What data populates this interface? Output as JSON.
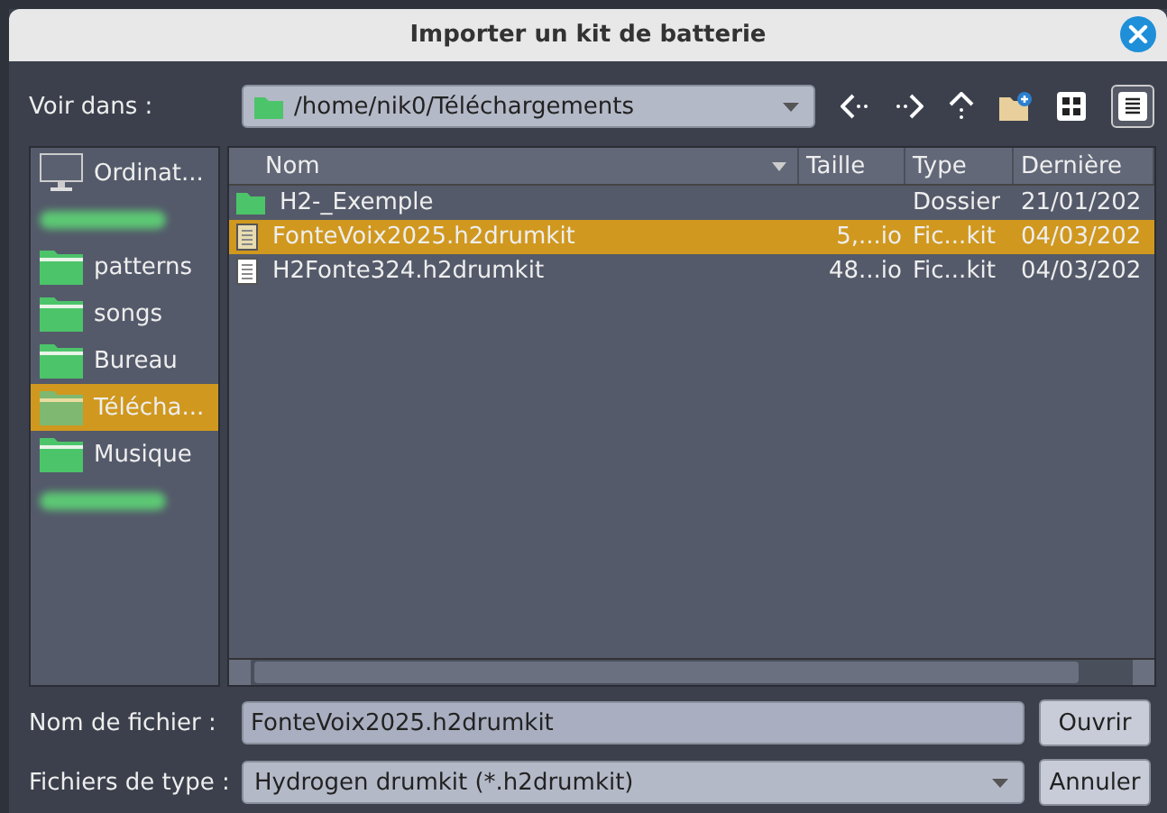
{
  "window": {
    "title": "Importer un kit de batterie"
  },
  "look_in": {
    "label": "Voir dans :",
    "path": "/home/nik0/Téléchargements"
  },
  "sidebar": {
    "items": [
      {
        "kind": "computer",
        "label": "Ordinat...",
        "selected": false
      },
      {
        "kind": "blurred",
        "selected": false
      },
      {
        "kind": "folder",
        "label": "patterns",
        "selected": false
      },
      {
        "kind": "folder",
        "label": "songs",
        "selected": false
      },
      {
        "kind": "folder",
        "label": "Bureau",
        "selected": false
      },
      {
        "kind": "folder",
        "label": "Télécha...",
        "selected": true
      },
      {
        "kind": "folder",
        "label": "Musique",
        "selected": false
      },
      {
        "kind": "blurred",
        "selected": false
      }
    ]
  },
  "table": {
    "columns": [
      "Nom",
      "Taille",
      "Type",
      "Dernière"
    ],
    "rows": [
      {
        "kind": "folder",
        "name": "H2-_Exemple",
        "size": "",
        "type": "Dossier",
        "date": "21/01/202",
        "selected": false
      },
      {
        "kind": "file",
        "name": "FonteVoix2025.h2drumkit",
        "size": "5,...io",
        "type": "Fic...kit",
        "date": "04/03/202",
        "selected": true
      },
      {
        "kind": "file",
        "name": "H2Fonte324.h2drumkit",
        "size": "48...io",
        "type": "Fic...kit",
        "date": "04/03/202",
        "selected": false
      }
    ]
  },
  "filename": {
    "label": "Nom de fichier :",
    "value": "FonteVoix2025.h2drumkit"
  },
  "filetype": {
    "label": "Fichiers de type :",
    "value": "Hydrogen drumkit (*.h2drumkit)"
  },
  "buttons": [
    "Ouvrir",
    "Annuler"
  ]
}
